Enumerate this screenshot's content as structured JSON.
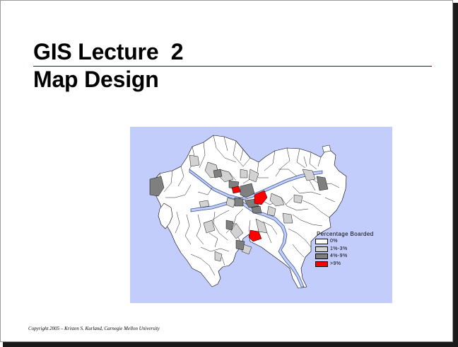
{
  "slide": {
    "title_line1": "GIS Lecture  2",
    "title_line2": "Map Design",
    "footer": "Copyright 2005 – Kristen S. Kurland, Carnegie Mellon University"
  },
  "map": {
    "background_color": "#c3cdfc",
    "legend": {
      "title": "Percentage Boarded",
      "items": [
        {
          "label": "0%",
          "color": "#ffffff"
        },
        {
          "label": "1%-3%",
          "color": "#d2d2d2"
        },
        {
          "label": "4%-9%",
          "color": "#7f7f7f"
        },
        {
          "label": ">9%",
          "color": "#ff0000"
        }
      ]
    }
  },
  "colors": {
    "title_rule": "#8b0000",
    "slide_shadow": "#1a1a1a",
    "river": "#c3cdfc"
  }
}
